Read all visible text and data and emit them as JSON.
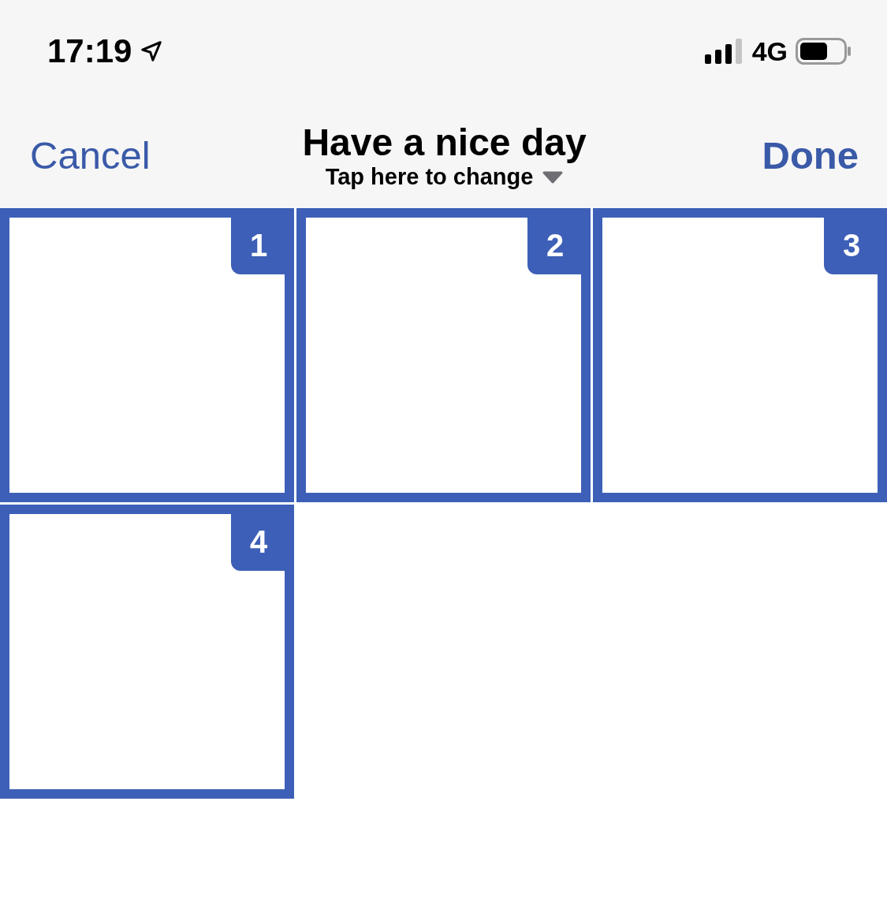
{
  "status_bar": {
    "time": "17:19",
    "network": "4G"
  },
  "nav": {
    "cancel": "Cancel",
    "title": "Have a nice day",
    "subtitle": "Tap here to change",
    "done": "Done"
  },
  "tiles": [
    {
      "number": "1",
      "selected": true
    },
    {
      "number": "2",
      "selected": true
    },
    {
      "number": "3",
      "selected": true
    },
    {
      "number": "4",
      "selected": true
    }
  ]
}
